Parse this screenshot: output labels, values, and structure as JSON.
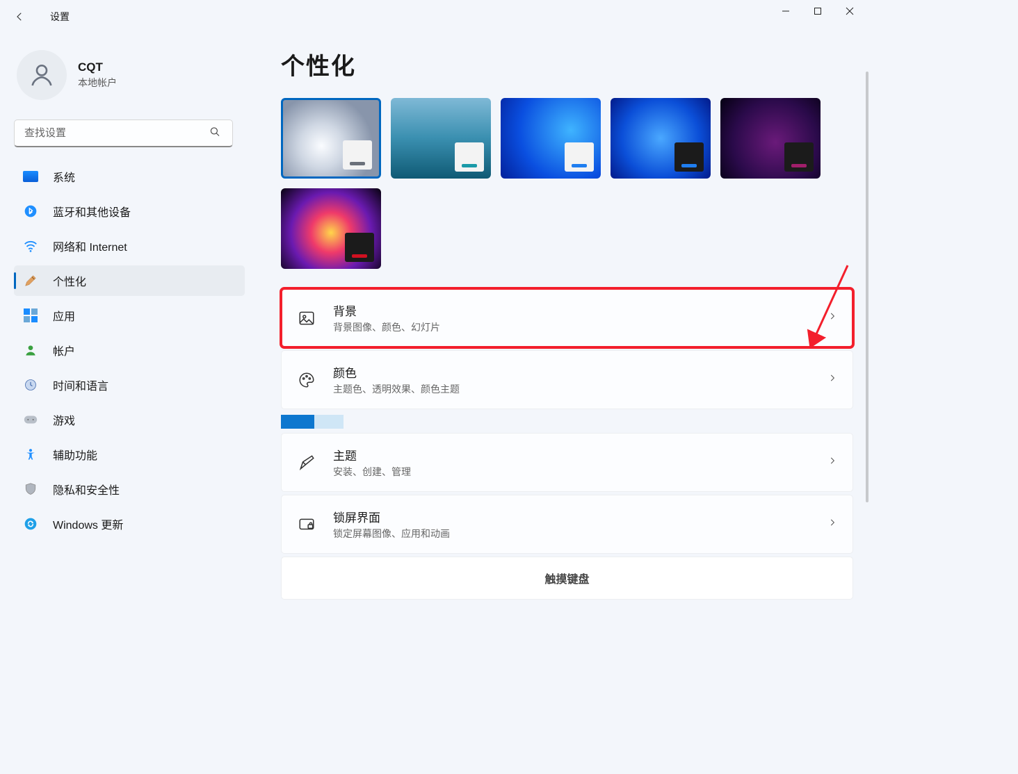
{
  "titlebar": {
    "title": "设置"
  },
  "profile": {
    "name": "CQT",
    "sub": "本地帐户"
  },
  "search": {
    "placeholder": "查找设置"
  },
  "nav": [
    {
      "id": "system",
      "label": "系统"
    },
    {
      "id": "bluetooth",
      "label": "蓝牙和其他设备"
    },
    {
      "id": "network",
      "label": "网络和 Internet"
    },
    {
      "id": "personalization",
      "label": "个性化",
      "active": true
    },
    {
      "id": "apps",
      "label": "应用"
    },
    {
      "id": "accounts",
      "label": "帐户"
    },
    {
      "id": "time",
      "label": "时间和语言"
    },
    {
      "id": "gaming",
      "label": "游戏"
    },
    {
      "id": "accessibility",
      "label": "辅助功能"
    },
    {
      "id": "privacy",
      "label": "隐私和安全性"
    },
    {
      "id": "update",
      "label": "Windows 更新"
    }
  ],
  "page": {
    "title": "个性化"
  },
  "themes": [
    {
      "bg": "radial-gradient(circle at 40% 60%, #fafcff 0%, #cfd7e3 30%, #8895ab 70%)",
      "mini_bg": "#f3f3f3",
      "accent": "#6b707a",
      "selected": true
    },
    {
      "bg": "linear-gradient(#7fb9d6 0%, #3a8fb0 50%, #0f5a74 100%)",
      "mini_bg": "#f3f3f3",
      "accent": "#1a9aa8"
    },
    {
      "bg": "radial-gradient(circle at 70% 40%, #3fb4ff 0%, #0a4fe0 60%, #03209a 100%)",
      "mini_bg": "#f3f3f3",
      "accent": "#1f7ef0"
    },
    {
      "bg": "radial-gradient(circle at 50% 50%, #4aa8ff 0%, #0b4fd8 60%, #021a8a 100%)",
      "mini_bg": "#1b1b1b",
      "accent": "#1f7ef0"
    },
    {
      "bg": "radial-gradient(circle at 55% 55%, #6a1a7a 0%, #2a0a4a 60%, #050012 100%)",
      "mini_bg": "#1b1b1b",
      "accent": "#a01e6a"
    },
    {
      "bg": "radial-gradient(circle at 50% 55%, #ffd64a 0%, #ef3a6a 30%, #6a1ab0 60%, #07020f 100%)",
      "mini_bg": "#1b1b1b",
      "accent": "#d01020"
    }
  ],
  "cards": [
    {
      "id": "background",
      "title": "背景",
      "sub": "背景图像、颜色、幻灯片",
      "highlighted": true
    },
    {
      "id": "colors",
      "title": "颜色",
      "sub": "主题色、透明效果、颜色主题"
    },
    {
      "id": "themes",
      "title": "主题",
      "sub": "安装、创建、管理"
    },
    {
      "id": "lockscreen",
      "title": "锁屏界面",
      "sub": "锁定屏幕图像、应用和动画"
    }
  ],
  "partial": {
    "label": "触摸键盘"
  }
}
